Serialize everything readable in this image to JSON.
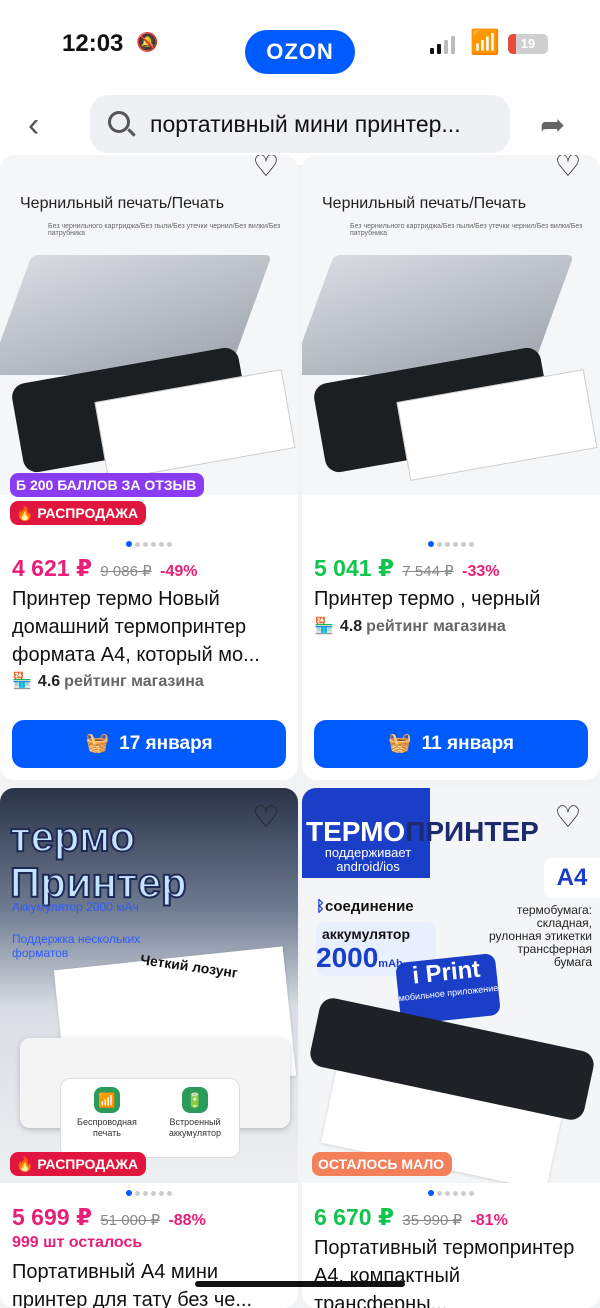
{
  "status": {
    "time": "12:03",
    "bell": "🔕",
    "battery": "19"
  },
  "brand": {
    "logo": "OZON",
    "accent": "#005bff"
  },
  "search": {
    "query": "портативный мини принтер...",
    "back_icon": "chevron-left-icon",
    "share_icon": "share-arrow-icon"
  },
  "products": [
    {
      "image_caption": "Чернильный печать/Печать",
      "image_sub": "Без чернильного картриджа/Без пыли/Без утечки чернил/Без вилки/Без патрубника",
      "badges": [
        "Б 200 БАЛЛОВ ЗА ОТЗЫВ",
        "🔥 РАСПРОДАЖА"
      ],
      "price": "4 621 ₽",
      "old_price": "9 086 ₽",
      "discount": "-49%",
      "title": "Принтер термо Новый домашний термопринтер формата А4, который мо...",
      "rating": "4.6",
      "rating_label": "рейтинг магазина",
      "delivery": "17 января"
    },
    {
      "image_caption": "Чернильный печать/Печать",
      "image_sub": "Без чернильного картриджа/Без пыли/Без утечки чернил/Без вилки/Без патрубника",
      "price": "5 041 ₽",
      "old_price": "7 544 ₽",
      "discount": "-33%",
      "title": "Принтер термо , черный",
      "rating": "4.8",
      "rating_label": "рейтинг магазина",
      "delivery": "11 января"
    },
    {
      "image_title": "термо Принтер",
      "image_lines": [
        "Аккумулятор 2000 мАч",
        "Поддержка нескольких форматов"
      ],
      "slogan": "Четкий лозунг",
      "feature_1": "Беспроводная печать",
      "feature_2": "Встроенный аккумулятор",
      "badge": "🔥 РАСПРОДАЖА",
      "price": "5 699 ₽",
      "old_price": "51 000 ₽",
      "discount": "-88%",
      "stock": "999 шт осталось",
      "title": "Портативный А4 мини принтер для тату без че..."
    },
    {
      "image_title_a": "ТЕРМО",
      "image_title_b": "ПРИНТЕР",
      "image_support": "поддерживает android/ios",
      "paper_size": "A4",
      "paper_types": "термобумага: складная, рулонная этикетки трансферная бумага",
      "connection": "соединение",
      "battery_label": "аккумулятор",
      "battery_value": "2000",
      "battery_unit": "mAh",
      "app_name": "i Print",
      "app_sub": "мобильное приложение",
      "badge": "ОСТАЛОСЬ МАЛО",
      "price": "6 670 ₽",
      "old_price": "35 990 ₽",
      "discount": "-81%",
      "title": "Портативный термопринтер А4, компактный трансферны..."
    }
  ]
}
